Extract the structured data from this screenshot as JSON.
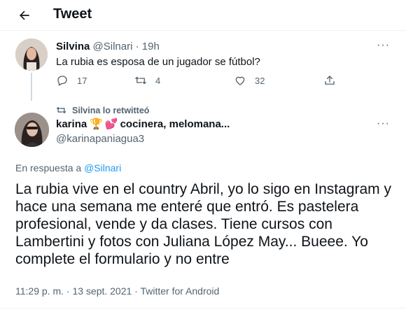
{
  "header": {
    "title": "Tweet",
    "back_icon": "arrow-left-icon"
  },
  "tweet1": {
    "name": "Silvina",
    "handle": "@Silnari",
    "separator": "·",
    "time": "19h",
    "text": "La rubia es esposa de un jugador se fútbol?",
    "more": "···",
    "actions": {
      "replies": "17",
      "retweets": "4",
      "likes": "32"
    }
  },
  "retweet_context": {
    "text": "Silvina lo retwitteó"
  },
  "tweet2": {
    "name_prefix": "karina",
    "name_suffix": "cocinera, melomana...",
    "emojis": [
      "🏆",
      "💕"
    ],
    "handle": "@karinapaniagua3",
    "more": "···",
    "reply_prefix": "En respuesta a",
    "reply_handle": "@Silnari",
    "text": "La rubia vive en el country Abril, yo lo sigo en Instagram y hace una semana me enteré que entró. Es pastelera profesional, vende y da clases. Tiene cursos con Lambertini y fotos con Juliana López May... Bueee. Yo complete el formulario y no entre",
    "meta": "11:29 p. m. · 13 sept. 2021 · Twitter for Android"
  },
  "colors": {
    "accent": "#1d9bf0",
    "muted": "#536471",
    "text": "#0f1419",
    "divider": "#eff3f4"
  }
}
